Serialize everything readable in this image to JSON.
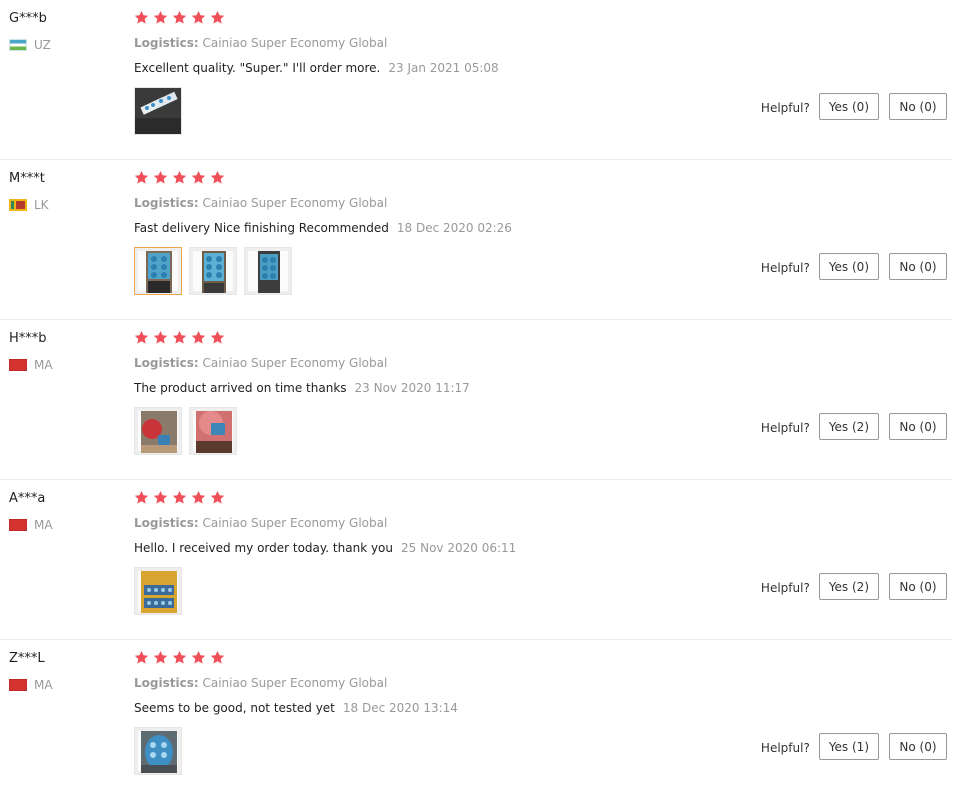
{
  "logistics_label": "Logistics:",
  "helpful_label": "Helpful?",
  "star_color": "#f0505a",
  "reviews": [
    {
      "user": "G***b",
      "country": "UZ",
      "flag": "uz",
      "stars": 5,
      "logistics": "Cainiao Super Economy Global",
      "text": "Excellent quality. \"Super.\" I'll order more.",
      "date": "23 Jan 2021 05:08",
      "photos": [
        "dark-package-photo"
      ],
      "yes": "Yes (0)",
      "no": "No (0)"
    },
    {
      "user": "M***t",
      "country": "LK",
      "flag": "lk",
      "stars": 5,
      "logistics": "Cainiao Super Economy Global",
      "text": "Fast delivery Nice finishing Recommended",
      "date": "18 Dec 2020 02:26",
      "photos": [
        "blister-pack-photo-1",
        "blister-pack-photo-2",
        "blister-pack-photo-3"
      ],
      "yes": "Yes (0)",
      "no": "No (0)"
    },
    {
      "user": "H***b",
      "country": "MA",
      "flag": "ma",
      "stars": 5,
      "logistics": "Cainiao Super Economy Global",
      "text": "The product arrived on time thanks",
      "date": "23 Nov 2020 11:17",
      "photos": [
        "red-bag-photo-1",
        "red-bag-photo-2"
      ],
      "yes": "Yes (2)",
      "no": "No (0)"
    },
    {
      "user": "A***a",
      "country": "MA",
      "flag": "ma",
      "stars": 5,
      "logistics": "Cainiao Super Economy Global",
      "text": "Hello. I received my order today. thank you",
      "date": "25 Nov 2020 06:11",
      "photos": [
        "yellow-envelope-photo"
      ],
      "yes": "Yes (2)",
      "no": "No (0)"
    },
    {
      "user": "Z***L",
      "country": "MA",
      "flag": "ma",
      "stars": 5,
      "logistics": "Cainiao Super Economy Global",
      "text": "Seems to be good, not tested yet",
      "date": "18 Dec 2020 13:14",
      "photos": [
        "blue-pills-photo"
      ],
      "yes": "Yes (1)",
      "no": "No (0)"
    }
  ]
}
